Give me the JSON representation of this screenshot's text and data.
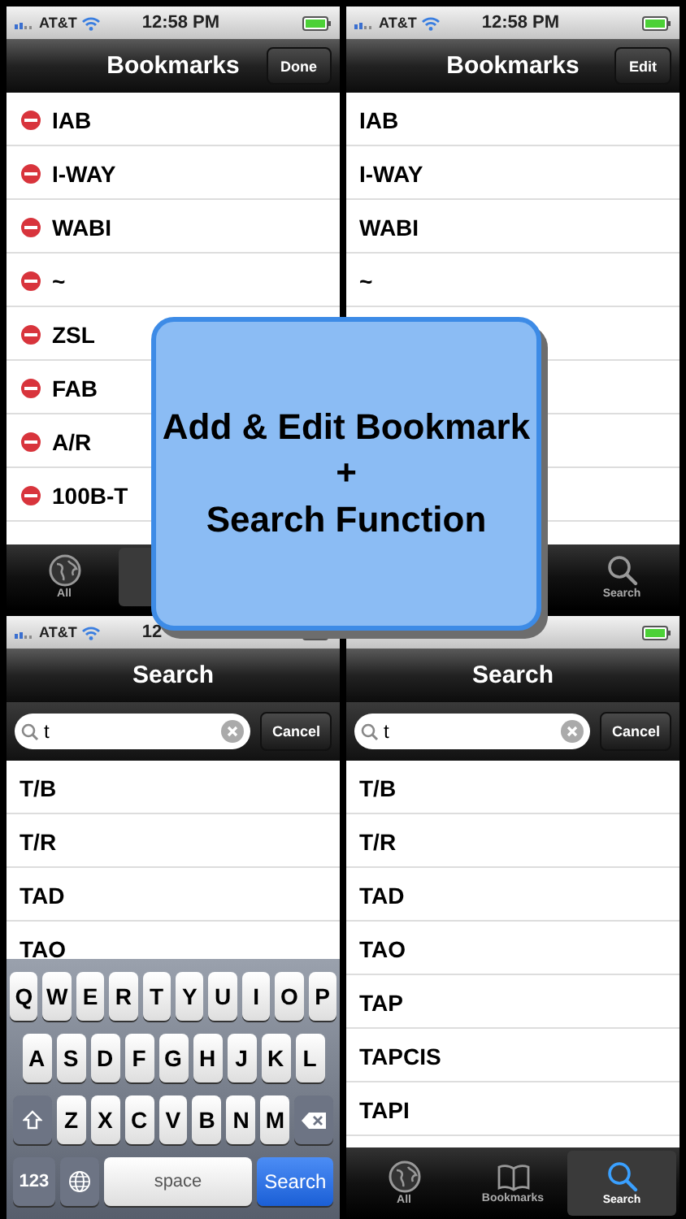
{
  "screens": [
    {
      "status": {
        "carrier": "AT&T",
        "time": "12:58 PM"
      },
      "nav": {
        "title": "Bookmarks",
        "button": "Done"
      },
      "list": {
        "kind": "edit",
        "rows": [
          "IAB",
          "I-WAY",
          "WABI",
          "~",
          "ZSL",
          "FAB",
          "A/R",
          "100B-T"
        ]
      },
      "bottom": {
        "kind": "tabbar",
        "tabs": [
          {
            "kind": "all",
            "label": "All",
            "selected": false
          },
          {
            "kind": "bookmarks",
            "selected": true
          }
        ]
      }
    },
    {
      "status": {
        "carrier": "AT&T",
        "time": "12:58 PM"
      },
      "nav": {
        "title": "Bookmarks",
        "button": "Edit"
      },
      "list": {
        "kind": "plain",
        "rows": [
          "IAB",
          "I-WAY",
          "WABI",
          "~"
        ]
      },
      "bottom": {
        "kind": "tabbar",
        "tabs": [
          {
            "kind": "search",
            "label": "Search",
            "selected": false
          }
        ]
      }
    },
    {
      "status": {
        "carrier": "AT&T",
        "time": "12"
      },
      "nav": {
        "title": "Search"
      },
      "search": {
        "value": "t",
        "button": "Cancel"
      },
      "list": {
        "kind": "plain",
        "rows": [
          "T/B",
          "T/R",
          "TAD",
          "TAO"
        ]
      },
      "bottom": {
        "kind": "keyboard",
        "rows": [
          {
            "keys": [
              {
                "label": "Q"
              },
              {
                "label": "W"
              },
              {
                "label": "E"
              },
              {
                "label": "R"
              },
              {
                "label": "T"
              },
              {
                "label": "Y"
              },
              {
                "label": "U"
              },
              {
                "label": "I"
              },
              {
                "label": "O"
              },
              {
                "label": "P"
              }
            ]
          },
          {
            "keys": [
              {
                "label": "A"
              },
              {
                "label": "S"
              },
              {
                "label": "D"
              },
              {
                "label": "F"
              },
              {
                "label": "G"
              },
              {
                "label": "H"
              },
              {
                "label": "J"
              },
              {
                "label": "K"
              },
              {
                "label": "L"
              }
            ]
          },
          {
            "keys": [
              {
                "kind": "shift"
              },
              {
                "label": "Z"
              },
              {
                "label": "X"
              },
              {
                "label": "C"
              },
              {
                "label": "V"
              },
              {
                "label": "B"
              },
              {
                "label": "N"
              },
              {
                "label": "M"
              },
              {
                "kind": "delete"
              }
            ]
          },
          {
            "keys": [
              {
                "kind": "mode",
                "label": "123"
              },
              {
                "kind": "globe"
              },
              {
                "kind": "space",
                "label": "space"
              },
              {
                "kind": "action",
                "label": "Search"
              }
            ]
          }
        ]
      }
    },
    {
      "nav": {
        "title": "Search"
      },
      "search": {
        "value": "t",
        "button": "Cancel"
      },
      "list": {
        "kind": "plain",
        "rows": [
          "T/B",
          "T/R",
          "TAD",
          "TAO",
          "TAP",
          "TAPCIS",
          "TAPI"
        ]
      },
      "bottom": {
        "kind": "tabbar",
        "tabs": [
          {
            "kind": "all",
            "label": "All",
            "selected": false
          },
          {
            "kind": "bookmarks",
            "label": "Bookmarks",
            "selected": false
          },
          {
            "kind": "search",
            "label": "Search",
            "selected": true
          }
        ]
      }
    }
  ],
  "callout": {
    "lines": [
      "Add & Edit Bookmark",
      "+",
      "Search Function"
    ]
  }
}
